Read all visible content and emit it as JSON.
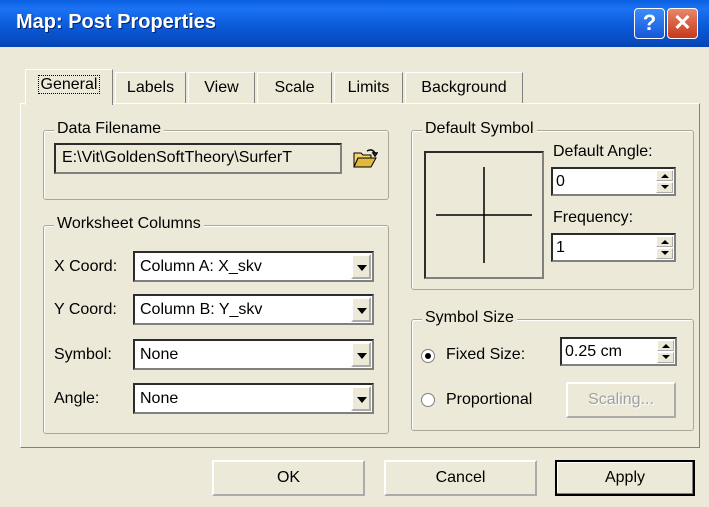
{
  "window": {
    "title": "Map: Post Properties",
    "help_label": "?",
    "close_label": "✕"
  },
  "tabs": [
    "General",
    "Labels",
    "View",
    "Scale",
    "Limits",
    "Background"
  ],
  "data_filename": {
    "group_label": "Data Filename",
    "value": "E:\\Vit\\GoldenSoftTheory\\SurferT",
    "browse_icon": "folder-open-icon"
  },
  "worksheet_columns": {
    "group_label": "Worksheet Columns",
    "x_coord": {
      "label": "X Coord:",
      "value": "Column A:  X_skv"
    },
    "y_coord": {
      "label": "Y Coord:",
      "value": "Column B:  Y_skv"
    },
    "symbol": {
      "label": "Symbol:",
      "value": "None"
    },
    "angle": {
      "label": "Angle:",
      "value": "None"
    }
  },
  "default_symbol": {
    "group_label": "Default Symbol",
    "symbol_icon": "plus-cross-icon",
    "angle_label": "Default Angle:",
    "angle_value": "0",
    "frequency_label": "Frequency:",
    "frequency_value": "1"
  },
  "symbol_size": {
    "group_label": "Symbol Size",
    "fixed_label": "Fixed Size:",
    "fixed_selected": true,
    "fixed_value": "0.25 cm",
    "proportional_label": "Proportional",
    "scaling_label": "Scaling..."
  },
  "buttons": {
    "ok": "OK",
    "cancel": "Cancel",
    "apply": "Apply"
  }
}
